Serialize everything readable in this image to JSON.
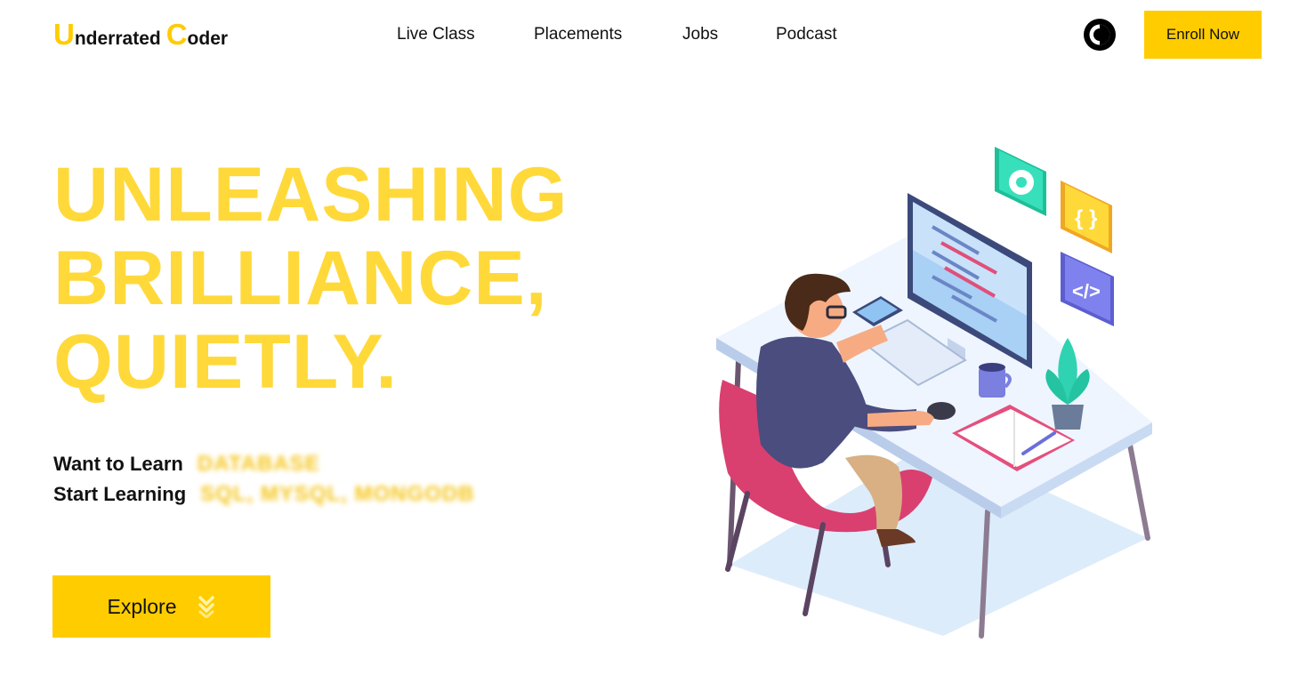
{
  "brand": {
    "first_initial": "U",
    "first_rest": "nderrated",
    "second_initial": "C",
    "second_rest": "oder",
    "accent_color": "#ffcc00"
  },
  "nav": {
    "items": [
      {
        "label": "Live Class"
      },
      {
        "label": "Placements"
      },
      {
        "label": "Jobs"
      },
      {
        "label": "Podcast"
      }
    ]
  },
  "header": {
    "theme_toggle_icon": "contrast-icon",
    "enroll_label": "Enroll Now"
  },
  "hero": {
    "title_lines": [
      "UNLEASHING",
      "BRILLIANCE,",
      "QUIETLY."
    ],
    "title_color": "#ffd93a",
    "want_label": "Want to Learn",
    "want_value": "DATABASE",
    "start_label": "Start Learning",
    "start_value": "SQL, MYSQL, MONGODB",
    "explore_label": "Explore",
    "explore_icon": "double-chevron-down-icon"
  },
  "illustration": {
    "icon": "developer-at-desk-illustration"
  }
}
